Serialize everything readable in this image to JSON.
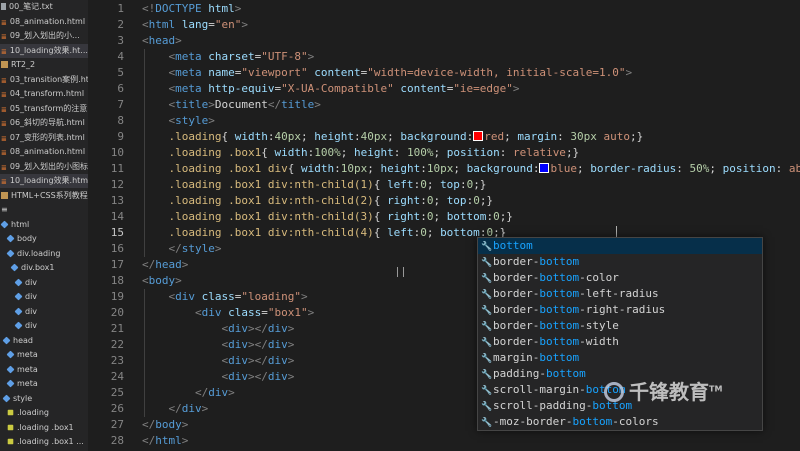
{
  "sidebar": {
    "items": [
      {
        "label": "00_笔记.txt",
        "icon": "file-icon",
        "sel": false
      },
      {
        "label": "08_animation.html",
        "icon": "html-icon",
        "sel": false
      },
      {
        "label": "09_划入划出的小...",
        "icon": "html-icon",
        "sel": false
      },
      {
        "label": "10_loading效果.ht...",
        "icon": "html-icon",
        "sel": true
      },
      {
        "label": "RT2_2",
        "icon": "folder-icon",
        "sel": false
      },
      {
        "label": "03_transition案例.html",
        "icon": "html-icon",
        "sel": false
      },
      {
        "label": "04_transform.html",
        "icon": "html-icon",
        "sel": false
      },
      {
        "label": "05_transform的注意...",
        "icon": "html-icon",
        "sel": false
      },
      {
        "label": "06_斜切的导航.html",
        "icon": "html-icon",
        "sel": false
      },
      {
        "label": "07_变形的列表.html",
        "icon": "html-icon",
        "sel": false
      },
      {
        "label": "08_animation.html",
        "icon": "html-icon",
        "sel": false
      },
      {
        "label": "09_划入划出的小图标...",
        "icon": "html-icon",
        "sel": false
      },
      {
        "label": "10_loading效果.html",
        "icon": "html-icon",
        "sel": true
      },
      {
        "label": "HTML+CSS系列教程...",
        "icon": "folder-icon",
        "sel": false
      },
      {
        "label": "≡",
        "icon": "none",
        "sel": false
      },
      {
        "label": "html",
        "icon": "cube-icon",
        "sel": false
      },
      {
        "label": "body",
        "icon": "cube-icon",
        "sel": false
      },
      {
        "label": "div.loading",
        "icon": "cube-icon",
        "sel": false
      },
      {
        "label": "div.box1",
        "icon": "cube-icon",
        "sel": false
      },
      {
        "label": "div",
        "icon": "cube-icon",
        "sel": false
      },
      {
        "label": "div",
        "icon": "cube-icon",
        "sel": false
      },
      {
        "label": "div",
        "icon": "cube-icon",
        "sel": false
      },
      {
        "label": "div",
        "icon": "cube-icon",
        "sel": false
      },
      {
        "label": "head",
        "icon": "cube-icon",
        "sel": false
      },
      {
        "label": "meta",
        "icon": "cube-icon",
        "sel": false
      },
      {
        "label": "meta",
        "icon": "cube-icon",
        "sel": false
      },
      {
        "label": "meta",
        "icon": "cube-icon",
        "sel": false
      },
      {
        "label": "style",
        "icon": "cube-icon",
        "sel": false
      },
      {
        "label": ".loading",
        "icon": "brace-icon",
        "sel": false
      },
      {
        "label": ".loading .box1",
        "icon": "brace-icon",
        "sel": false
      },
      {
        "label": ".loading .box1 ...",
        "icon": "brace-icon",
        "sel": false
      }
    ]
  },
  "editor": {
    "line_numbers": [
      "1",
      "2",
      "3",
      "4",
      "5",
      "6",
      "7",
      "8",
      "9",
      "10",
      "11",
      "12",
      "13",
      "14",
      "15",
      "16",
      "17",
      "18",
      "19",
      "20",
      "21",
      "22",
      "23",
      "24",
      "25",
      "26",
      "27",
      "28"
    ],
    "current_line": "15",
    "lines": [
      [
        [
          "br",
          "<!"
        ],
        [
          "tg",
          "DOCTYPE"
        ],
        [
          "at",
          " html"
        ],
        [
          "br",
          ">"
        ]
      ],
      [
        [
          "br",
          "<"
        ],
        [
          "tg",
          "html"
        ],
        [
          "at",
          " lang"
        ],
        [
          "pn",
          "="
        ],
        [
          "st",
          "\"en\""
        ],
        [
          "br",
          ">"
        ]
      ],
      [
        [
          "br",
          "<"
        ],
        [
          "tg",
          "head"
        ],
        [
          "br",
          ">"
        ]
      ],
      [
        [
          "pn",
          "    "
        ],
        [
          "br",
          "<"
        ],
        [
          "tg",
          "meta"
        ],
        [
          "at",
          " charset"
        ],
        [
          "pn",
          "="
        ],
        [
          "st",
          "\"UTF-8\""
        ],
        [
          "br",
          ">"
        ]
      ],
      [
        [
          "pn",
          "    "
        ],
        [
          "br",
          "<"
        ],
        [
          "tg",
          "meta"
        ],
        [
          "at",
          " name"
        ],
        [
          "pn",
          "="
        ],
        [
          "st",
          "\"viewport\""
        ],
        [
          "at",
          " content"
        ],
        [
          "pn",
          "="
        ],
        [
          "st",
          "\"width=device-width, initial-scale=1.0\""
        ],
        [
          "br",
          ">"
        ]
      ],
      [
        [
          "pn",
          "    "
        ],
        [
          "br",
          "<"
        ],
        [
          "tg",
          "meta"
        ],
        [
          "at",
          " http-equiv"
        ],
        [
          "pn",
          "="
        ],
        [
          "st",
          "\"X-UA-Compatible\""
        ],
        [
          "at",
          " content"
        ],
        [
          "pn",
          "="
        ],
        [
          "st",
          "\"ie=edge\""
        ],
        [
          "br",
          ">"
        ]
      ],
      [
        [
          "pn",
          "    "
        ],
        [
          "br",
          "<"
        ],
        [
          "tg",
          "title"
        ],
        [
          "br",
          ">"
        ],
        [
          "pn",
          "Document"
        ],
        [
          "br",
          "</"
        ],
        [
          "tg",
          "title"
        ],
        [
          "br",
          ">"
        ]
      ],
      [
        [
          "pn",
          "    "
        ],
        [
          "br",
          "<"
        ],
        [
          "tg",
          "style"
        ],
        [
          "br",
          ">"
        ]
      ],
      [
        [
          "pn",
          "    "
        ],
        [
          "sel-n",
          ".loading"
        ],
        [
          "pn",
          "{ "
        ],
        [
          "pr",
          "width"
        ],
        [
          "pn",
          ":"
        ],
        [
          "num",
          "40px"
        ],
        [
          "pn",
          "; "
        ],
        [
          "pr",
          "height"
        ],
        [
          "pn",
          ":"
        ],
        [
          "num",
          "40px"
        ],
        [
          "pn",
          "; "
        ],
        [
          "pr",
          "background"
        ],
        [
          "pn",
          ":"
        ],
        [
          "sw",
          "#ff0000"
        ],
        [
          "vl",
          "red"
        ],
        [
          "pn",
          "; "
        ],
        [
          "pr",
          "margin"
        ],
        [
          "pn",
          ": "
        ],
        [
          "num",
          "30px"
        ],
        [
          "vl",
          " auto"
        ],
        [
          "pn",
          ";}"
        ]
      ],
      [
        [
          "pn",
          "    "
        ],
        [
          "sel-n",
          ".loading .box1"
        ],
        [
          "pn",
          "{ "
        ],
        [
          "pr",
          "width"
        ],
        [
          "pn",
          ":"
        ],
        [
          "num",
          "100%"
        ],
        [
          "pn",
          "; "
        ],
        [
          "pr",
          "height"
        ],
        [
          "pn",
          ": "
        ],
        [
          "num",
          "100%"
        ],
        [
          "pn",
          "; "
        ],
        [
          "pr",
          "position"
        ],
        [
          "pn",
          ": "
        ],
        [
          "vl",
          "relative"
        ],
        [
          "pn",
          ";}"
        ]
      ],
      [
        [
          "pn",
          "    "
        ],
        [
          "sel-n",
          ".loading .box1 div"
        ],
        [
          "pn",
          "{ "
        ],
        [
          "pr",
          "width"
        ],
        [
          "pn",
          ":"
        ],
        [
          "num",
          "10px"
        ],
        [
          "pn",
          "; "
        ],
        [
          "pr",
          "height"
        ],
        [
          "pn",
          ":"
        ],
        [
          "num",
          "10px"
        ],
        [
          "pn",
          "; "
        ],
        [
          "pr",
          "background"
        ],
        [
          "pn",
          ":"
        ],
        [
          "sw",
          "#0000ff"
        ],
        [
          "vl",
          "blue"
        ],
        [
          "pn",
          "; "
        ],
        [
          "pr",
          "border-radius"
        ],
        [
          "pn",
          ": "
        ],
        [
          "num",
          "50%"
        ],
        [
          "pn",
          "; "
        ],
        [
          "pr",
          "position"
        ],
        [
          "pn",
          ": "
        ],
        [
          "vl",
          "abs"
        ]
      ],
      [
        [
          "pn",
          "    "
        ],
        [
          "sel-n",
          ".loading .box1 div:nth-child(1)"
        ],
        [
          "pn",
          "{ "
        ],
        [
          "pr",
          "left"
        ],
        [
          "pn",
          ":"
        ],
        [
          "num",
          "0"
        ],
        [
          "pn",
          "; "
        ],
        [
          "pr",
          "top"
        ],
        [
          "pn",
          ":"
        ],
        [
          "num",
          "0"
        ],
        [
          "pn",
          ";}"
        ]
      ],
      [
        [
          "pn",
          "    "
        ],
        [
          "sel-n",
          ".loading .box1 div:nth-child(2)"
        ],
        [
          "pn",
          "{ "
        ],
        [
          "pr",
          "right"
        ],
        [
          "pn",
          ":"
        ],
        [
          "num",
          "0"
        ],
        [
          "pn",
          "; "
        ],
        [
          "pr",
          "top"
        ],
        [
          "pn",
          ":"
        ],
        [
          "num",
          "0"
        ],
        [
          "pn",
          ";}"
        ]
      ],
      [
        [
          "pn",
          "    "
        ],
        [
          "sel-n",
          ".loading .box1 div:nth-child(3)"
        ],
        [
          "pn",
          "{ "
        ],
        [
          "pr",
          "right"
        ],
        [
          "pn",
          ":"
        ],
        [
          "num",
          "0"
        ],
        [
          "pn",
          "; "
        ],
        [
          "pr",
          "bottom"
        ],
        [
          "pn",
          ":"
        ],
        [
          "num",
          "0"
        ],
        [
          "pn",
          ";}"
        ]
      ],
      [
        [
          "pn",
          "    "
        ],
        [
          "sel-n",
          ".loading .box1 div:nth-child(4)"
        ],
        [
          "pn",
          "{ "
        ],
        [
          "pr",
          "left"
        ],
        [
          "pn",
          ":"
        ],
        [
          "num",
          "0"
        ],
        [
          "pn",
          "; "
        ],
        [
          "pr",
          "bottom"
        ],
        [
          "pn",
          ":"
        ],
        [
          "num",
          "0"
        ],
        [
          "pn",
          ";}"
        ]
      ],
      [
        [
          "pn",
          "    "
        ],
        [
          "br",
          "</"
        ],
        [
          "tg",
          "style"
        ],
        [
          "br",
          ">"
        ]
      ],
      [
        [
          "br",
          "</"
        ],
        [
          "tg",
          "head"
        ],
        [
          "br",
          ">"
        ]
      ],
      [
        [
          "br",
          "<"
        ],
        [
          "tg",
          "body"
        ],
        [
          "br",
          ">"
        ]
      ],
      [
        [
          "pn",
          "    "
        ],
        [
          "br",
          "<"
        ],
        [
          "tg",
          "div"
        ],
        [
          "at",
          " class"
        ],
        [
          "pn",
          "="
        ],
        [
          "st",
          "\"loading\""
        ],
        [
          "br",
          ">"
        ]
      ],
      [
        [
          "pn",
          "        "
        ],
        [
          "br",
          "<"
        ],
        [
          "tg",
          "div"
        ],
        [
          "at",
          " class"
        ],
        [
          "pn",
          "="
        ],
        [
          "st",
          "\"box1\""
        ],
        [
          "br",
          ">"
        ]
      ],
      [
        [
          "pn",
          "            "
        ],
        [
          "br",
          "<"
        ],
        [
          "tg",
          "div"
        ],
        [
          "br",
          "></"
        ],
        [
          "tg",
          "div"
        ],
        [
          "br",
          ">"
        ]
      ],
      [
        [
          "pn",
          "            "
        ],
        [
          "br",
          "<"
        ],
        [
          "tg",
          "div"
        ],
        [
          "br",
          "></"
        ],
        [
          "tg",
          "div"
        ],
        [
          "br",
          ">"
        ]
      ],
      [
        [
          "pn",
          "            "
        ],
        [
          "br",
          "<"
        ],
        [
          "tg",
          "div"
        ],
        [
          "br",
          "></"
        ],
        [
          "tg",
          "div"
        ],
        [
          "br",
          ">"
        ]
      ],
      [
        [
          "pn",
          "            "
        ],
        [
          "br",
          "<"
        ],
        [
          "tg",
          "div"
        ],
        [
          "br",
          "></"
        ],
        [
          "tg",
          "div"
        ],
        [
          "br",
          ">"
        ]
      ],
      [
        [
          "pn",
          "        "
        ],
        [
          "br",
          "</"
        ],
        [
          "tg",
          "div"
        ],
        [
          "br",
          ">"
        ]
      ],
      [
        [
          "pn",
          "    "
        ],
        [
          "br",
          "</"
        ],
        [
          "tg",
          "div"
        ],
        [
          "br",
          ">"
        ]
      ],
      [
        [
          "br",
          "</"
        ],
        [
          "tg",
          "body"
        ],
        [
          "br",
          ">"
        ]
      ],
      [
        [
          "br",
          "</"
        ],
        [
          "tg",
          "html"
        ],
        [
          "br",
          ">"
        ]
      ]
    ]
  },
  "suggest": {
    "typed": "bottom",
    "items": [
      {
        "pre": "",
        "match": "bottom",
        "post": "",
        "active": true
      },
      {
        "pre": "border-",
        "match": "bottom",
        "post": "",
        "active": false
      },
      {
        "pre": "border-",
        "match": "bottom",
        "post": "-color",
        "active": false
      },
      {
        "pre": "border-",
        "match": "bottom",
        "post": "-left-radius",
        "active": false
      },
      {
        "pre": "border-",
        "match": "bottom",
        "post": "-right-radius",
        "active": false
      },
      {
        "pre": "border-",
        "match": "bottom",
        "post": "-style",
        "active": false
      },
      {
        "pre": "border-",
        "match": "bottom",
        "post": "-width",
        "active": false
      },
      {
        "pre": "margin-",
        "match": "bottom",
        "post": "",
        "active": false
      },
      {
        "pre": "padding-",
        "match": "bottom",
        "post": "",
        "active": false
      },
      {
        "pre": "scroll-margin-",
        "match": "bottom",
        "post": "",
        "active": false
      },
      {
        "pre": "scroll-padding-",
        "match": "bottom",
        "post": "",
        "active": false
      },
      {
        "pre": "-moz-border-",
        "match": "bottom",
        "post": "-colors",
        "active": false
      }
    ],
    "info_icon": "i"
  },
  "watermark": {
    "text": "千锋教育",
    "tm": "TM"
  }
}
